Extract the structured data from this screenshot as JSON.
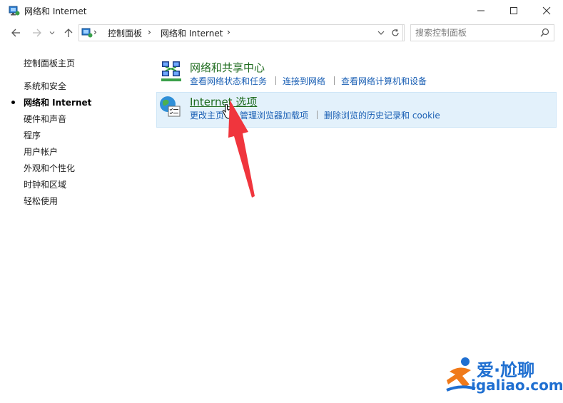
{
  "window": {
    "title": "网络和 Internet",
    "minimize_icon": "minimize-icon",
    "maximize_icon": "maximize-icon",
    "close_icon": "close-icon"
  },
  "address_bar": {
    "breadcrumbs": [
      "控制面板",
      "网络和 Internet"
    ],
    "search_placeholder": "搜索控制面板"
  },
  "sidebar": {
    "items": [
      {
        "label": "控制面板主页",
        "current": false
      },
      {
        "label": "系统和安全",
        "current": false
      },
      {
        "label": "网络和 Internet",
        "current": true
      },
      {
        "label": "硬件和声音",
        "current": false
      },
      {
        "label": "程序",
        "current": false
      },
      {
        "label": "用户帐户",
        "current": false
      },
      {
        "label": "外观和个性化",
        "current": false
      },
      {
        "label": "时钟和区域",
        "current": false
      },
      {
        "label": "轻松使用",
        "current": false
      }
    ]
  },
  "categories": [
    {
      "title": "网络和共享中心",
      "icon": "network-sharing-icon",
      "links": [
        "查看网络状态和任务",
        "连接到网络",
        "查看网络计算机和设备"
      ]
    },
    {
      "title": "Internet 选项",
      "icon": "internet-options-icon",
      "links": [
        "更改主页",
        "管理浏览器加载项",
        "删除浏览的历史记录和 cookie"
      ]
    }
  ],
  "watermark": {
    "brand_text": "爱·尬聊",
    "domain_text": "igaliao.com"
  },
  "colors": {
    "link": "#1a5fb4",
    "category_title": "#1e6b1e",
    "hover_bg": "#e3f1fb",
    "annotation_arrow": "#f0353d",
    "watermark_blue": "#1f6fd1",
    "watermark_orange": "#f07a1a"
  }
}
